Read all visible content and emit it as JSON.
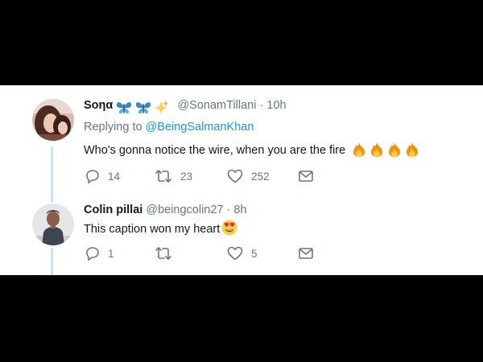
{
  "tweets": [
    {
      "display_name": "Soηα",
      "name_emojis": [
        "butterfly-icon",
        "butterfly-icon",
        "sparkles-icon"
      ],
      "handle": "@SonamTillani",
      "separator": "·",
      "time": "10h",
      "replying_label": "Replying to",
      "replying_to": "@BeingSalmanKhan",
      "text": "Who's gonna notice the wire, when you are the fire",
      "text_emojis": [
        "fire-icon",
        "fire-icon",
        "fire-icon",
        "fire-icon"
      ],
      "replies": "14",
      "retweets": "23",
      "likes": "252"
    },
    {
      "display_name": "Colin pillai",
      "handle": "@beingcolin27",
      "separator": "·",
      "time": "8h",
      "text": "This caption won my heart",
      "text_emojis": [
        "heart-eyes-icon"
      ],
      "replies": "1",
      "retweets": "",
      "likes": "5"
    }
  ],
  "colors": {
    "background": "#000000",
    "card": "#ffffff",
    "accent": "#1b95e0",
    "muted": "#657786",
    "text": "#14171a",
    "thread_line": "#c4e5f7"
  }
}
